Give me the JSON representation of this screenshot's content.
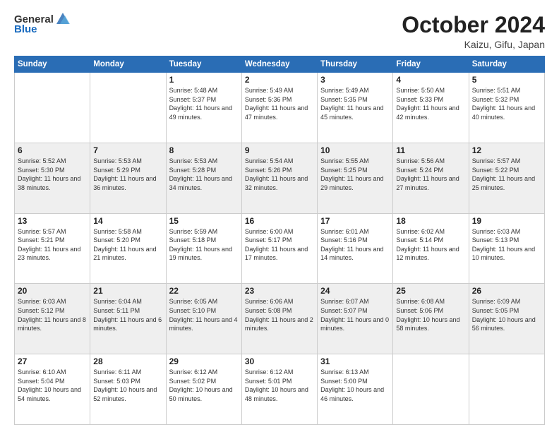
{
  "header": {
    "logo_general": "General",
    "logo_blue": "Blue",
    "month_title": "October 2024",
    "location": "Kaizu, Gifu, Japan"
  },
  "weekdays": [
    "Sunday",
    "Monday",
    "Tuesday",
    "Wednesday",
    "Thursday",
    "Friday",
    "Saturday"
  ],
  "weeks": [
    [
      {
        "day": "",
        "info": ""
      },
      {
        "day": "",
        "info": ""
      },
      {
        "day": "1",
        "info": "Sunrise: 5:48 AM\nSunset: 5:37 PM\nDaylight: 11 hours and 49 minutes."
      },
      {
        "day": "2",
        "info": "Sunrise: 5:49 AM\nSunset: 5:36 PM\nDaylight: 11 hours and 47 minutes."
      },
      {
        "day": "3",
        "info": "Sunrise: 5:49 AM\nSunset: 5:35 PM\nDaylight: 11 hours and 45 minutes."
      },
      {
        "day": "4",
        "info": "Sunrise: 5:50 AM\nSunset: 5:33 PM\nDaylight: 11 hours and 42 minutes."
      },
      {
        "day": "5",
        "info": "Sunrise: 5:51 AM\nSunset: 5:32 PM\nDaylight: 11 hours and 40 minutes."
      }
    ],
    [
      {
        "day": "6",
        "info": "Sunrise: 5:52 AM\nSunset: 5:30 PM\nDaylight: 11 hours and 38 minutes."
      },
      {
        "day": "7",
        "info": "Sunrise: 5:53 AM\nSunset: 5:29 PM\nDaylight: 11 hours and 36 minutes."
      },
      {
        "day": "8",
        "info": "Sunrise: 5:53 AM\nSunset: 5:28 PM\nDaylight: 11 hours and 34 minutes."
      },
      {
        "day": "9",
        "info": "Sunrise: 5:54 AM\nSunset: 5:26 PM\nDaylight: 11 hours and 32 minutes."
      },
      {
        "day": "10",
        "info": "Sunrise: 5:55 AM\nSunset: 5:25 PM\nDaylight: 11 hours and 29 minutes."
      },
      {
        "day": "11",
        "info": "Sunrise: 5:56 AM\nSunset: 5:24 PM\nDaylight: 11 hours and 27 minutes."
      },
      {
        "day": "12",
        "info": "Sunrise: 5:57 AM\nSunset: 5:22 PM\nDaylight: 11 hours and 25 minutes."
      }
    ],
    [
      {
        "day": "13",
        "info": "Sunrise: 5:57 AM\nSunset: 5:21 PM\nDaylight: 11 hours and 23 minutes."
      },
      {
        "day": "14",
        "info": "Sunrise: 5:58 AM\nSunset: 5:20 PM\nDaylight: 11 hours and 21 minutes."
      },
      {
        "day": "15",
        "info": "Sunrise: 5:59 AM\nSunset: 5:18 PM\nDaylight: 11 hours and 19 minutes."
      },
      {
        "day": "16",
        "info": "Sunrise: 6:00 AM\nSunset: 5:17 PM\nDaylight: 11 hours and 17 minutes."
      },
      {
        "day": "17",
        "info": "Sunrise: 6:01 AM\nSunset: 5:16 PM\nDaylight: 11 hours and 14 minutes."
      },
      {
        "day": "18",
        "info": "Sunrise: 6:02 AM\nSunset: 5:14 PM\nDaylight: 11 hours and 12 minutes."
      },
      {
        "day": "19",
        "info": "Sunrise: 6:03 AM\nSunset: 5:13 PM\nDaylight: 11 hours and 10 minutes."
      }
    ],
    [
      {
        "day": "20",
        "info": "Sunrise: 6:03 AM\nSunset: 5:12 PM\nDaylight: 11 hours and 8 minutes."
      },
      {
        "day": "21",
        "info": "Sunrise: 6:04 AM\nSunset: 5:11 PM\nDaylight: 11 hours and 6 minutes."
      },
      {
        "day": "22",
        "info": "Sunrise: 6:05 AM\nSunset: 5:10 PM\nDaylight: 11 hours and 4 minutes."
      },
      {
        "day": "23",
        "info": "Sunrise: 6:06 AM\nSunset: 5:08 PM\nDaylight: 11 hours and 2 minutes."
      },
      {
        "day": "24",
        "info": "Sunrise: 6:07 AM\nSunset: 5:07 PM\nDaylight: 11 hours and 0 minutes."
      },
      {
        "day": "25",
        "info": "Sunrise: 6:08 AM\nSunset: 5:06 PM\nDaylight: 10 hours and 58 minutes."
      },
      {
        "day": "26",
        "info": "Sunrise: 6:09 AM\nSunset: 5:05 PM\nDaylight: 10 hours and 56 minutes."
      }
    ],
    [
      {
        "day": "27",
        "info": "Sunrise: 6:10 AM\nSunset: 5:04 PM\nDaylight: 10 hours and 54 minutes."
      },
      {
        "day": "28",
        "info": "Sunrise: 6:11 AM\nSunset: 5:03 PM\nDaylight: 10 hours and 52 minutes."
      },
      {
        "day": "29",
        "info": "Sunrise: 6:12 AM\nSunset: 5:02 PM\nDaylight: 10 hours and 50 minutes."
      },
      {
        "day": "30",
        "info": "Sunrise: 6:12 AM\nSunset: 5:01 PM\nDaylight: 10 hours and 48 minutes."
      },
      {
        "day": "31",
        "info": "Sunrise: 6:13 AM\nSunset: 5:00 PM\nDaylight: 10 hours and 46 minutes."
      },
      {
        "day": "",
        "info": ""
      },
      {
        "day": "",
        "info": ""
      }
    ]
  ]
}
